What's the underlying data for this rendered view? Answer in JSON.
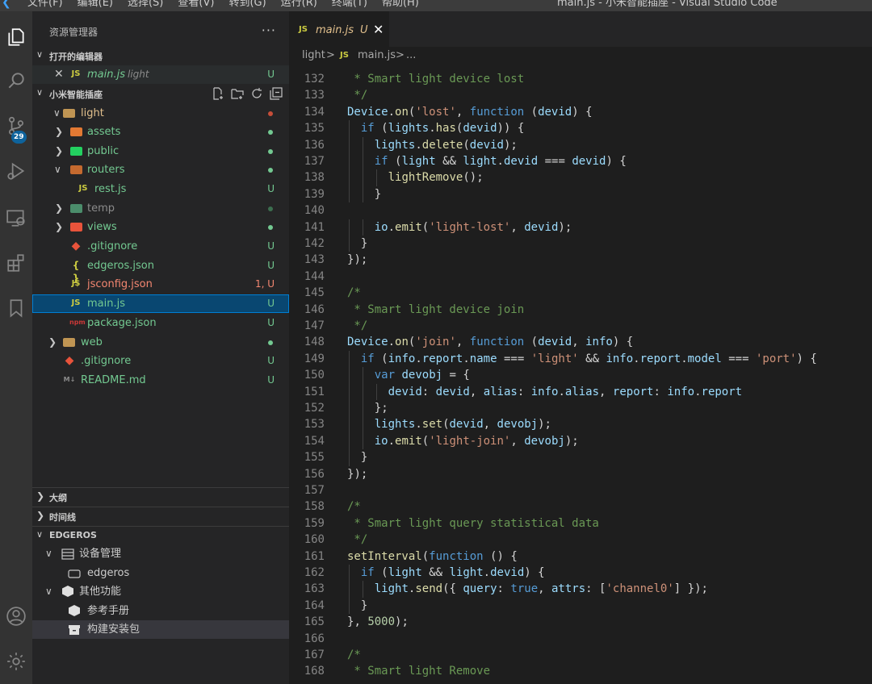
{
  "window": {
    "menu": [
      "文件(F)",
      "编辑(E)",
      "选择(S)",
      "查看(V)",
      "转到(G)",
      "运行(R)",
      "终端(T)",
      "帮助(H)"
    ],
    "title": "main.js - 小米智能插座 - Visual Studio Code"
  },
  "activity_bar": {
    "items": [
      {
        "name": "explorer-icon",
        "active": true
      },
      {
        "name": "search-icon"
      },
      {
        "name": "source-control-icon",
        "badge": "29"
      },
      {
        "name": "run-debug-icon"
      },
      {
        "name": "remote-explorer-icon"
      },
      {
        "name": "extensions-icon"
      },
      {
        "name": "bookmarks-icon"
      }
    ],
    "bottom": [
      {
        "name": "account-icon"
      },
      {
        "name": "settings-gear-icon"
      }
    ]
  },
  "sidebar": {
    "title": "资源管理器",
    "more": "···",
    "open_editors": {
      "label": "打开的编辑器",
      "items": [
        {
          "icon": "JS",
          "name": "main.js",
          "folder": "light",
          "status": "U"
        }
      ]
    },
    "workspace": {
      "label": "小米智能插座",
      "tree": [
        {
          "name": "light",
          "kind": "folder",
          "depth": 1,
          "expanded": true,
          "dot": "#c74e39",
          "color": "mod"
        },
        {
          "name": "assets",
          "kind": "folder",
          "depth": 2,
          "expanded": false,
          "dot": "#73c991",
          "color": "green",
          "icon_color": "#e37933"
        },
        {
          "name": "public",
          "kind": "folder",
          "depth": 2,
          "expanded": false,
          "dot": "#73c991",
          "color": "green",
          "icon_color": "#23d160"
        },
        {
          "name": "routers",
          "kind": "folder",
          "depth": 2,
          "expanded": true,
          "dot": "#73c991",
          "color": "green",
          "icon_color": "#c56a2f"
        },
        {
          "name": "rest.js",
          "kind": "js",
          "depth": 3,
          "status": "U",
          "color": "green"
        },
        {
          "name": "temp",
          "kind": "folder",
          "depth": 2,
          "expanded": false,
          "dot": "#3c6f4f",
          "color": "dim",
          "icon_color": "#4b8d6b"
        },
        {
          "name": "views",
          "kind": "folder",
          "depth": 2,
          "expanded": false,
          "dot": "#73c991",
          "color": "green",
          "icon_color": "#e8533b"
        },
        {
          "name": ".gitignore",
          "kind": "git",
          "depth": 2,
          "status": "U",
          "color": "green"
        },
        {
          "name": "edgeros.json",
          "kind": "json",
          "depth": 2,
          "status": "U",
          "color": "green"
        },
        {
          "name": "jsconfig.json",
          "kind": "js",
          "depth": 2,
          "status": "1, U",
          "color": "err"
        },
        {
          "name": "main.js",
          "kind": "js",
          "depth": 2,
          "status": "U",
          "color": "green",
          "selected": true
        },
        {
          "name": "package.json",
          "kind": "npm",
          "depth": 2,
          "status": "U",
          "color": "green"
        },
        {
          "name": "web",
          "kind": "folder",
          "depth": 1,
          "expanded": false,
          "dot": "#73c991",
          "color": "green"
        },
        {
          "name": ".gitignore",
          "kind": "git",
          "depth": 1,
          "status": "U",
          "color": "green"
        },
        {
          "name": "README.md",
          "kind": "md",
          "depth": 1,
          "status": "U",
          "color": "green"
        }
      ]
    },
    "outline": {
      "label": "大纲"
    },
    "timeline": {
      "label": "时间线"
    },
    "edgeros": {
      "label": "EDGEROS",
      "items": [
        {
          "label": "设备管理",
          "depth": 1,
          "icon": "list-icon"
        },
        {
          "label": "edgeros",
          "depth": 2,
          "icon": "device-icon"
        },
        {
          "label": "其他功能",
          "depth": 1,
          "icon": "package-icon"
        },
        {
          "label": "参考手册",
          "depth": 2,
          "icon": "package-icon"
        },
        {
          "label": "构建安装包",
          "depth": 2,
          "icon": "archive-icon"
        }
      ]
    }
  },
  "editor": {
    "tab": {
      "icon": "JS",
      "name": "main.js",
      "status": "U",
      "close": "✕"
    },
    "breadcrumb": [
      "light",
      ">",
      "JS",
      "main.js",
      ">",
      "..."
    ],
    "code": [
      {
        "n": "132",
        "t": " * Smart light device lost"
      },
      {
        "n": "133",
        "t": " */"
      },
      {
        "n": "134",
        "t": "Device.on('lost', function (devid) {"
      },
      {
        "n": "135",
        "t": "  if (lights.has(devid)) {"
      },
      {
        "n": "136",
        "t": "    lights.delete(devid);"
      },
      {
        "n": "137",
        "t": "    if (light && light.devid === devid) {"
      },
      {
        "n": "138",
        "t": "      lightRemove();"
      },
      {
        "n": "139",
        "t": "    }"
      },
      {
        "n": "140",
        "t": ""
      },
      {
        "n": "141",
        "t": "    io.emit('light-lost', devid);"
      },
      {
        "n": "142",
        "t": "  }"
      },
      {
        "n": "143",
        "t": "});"
      },
      {
        "n": "144",
        "t": ""
      },
      {
        "n": "145",
        "t": "/*"
      },
      {
        "n": "146",
        "t": " * Smart light device join"
      },
      {
        "n": "147",
        "t": " */"
      },
      {
        "n": "148",
        "t": "Device.on('join', function (devid, info) {"
      },
      {
        "n": "149",
        "t": "  if (info.report.name === 'light' && info.report.model === 'port') {"
      },
      {
        "n": "150",
        "t": "    var devobj = {"
      },
      {
        "n": "151",
        "t": "      devid: devid, alias: info.alias, report: info.report"
      },
      {
        "n": "152",
        "t": "    };"
      },
      {
        "n": "153",
        "t": "    lights.set(devid, devobj);"
      },
      {
        "n": "154",
        "t": "    io.emit('light-join', devobj);"
      },
      {
        "n": "155",
        "t": "  }"
      },
      {
        "n": "156",
        "t": "});"
      },
      {
        "n": "157",
        "t": ""
      },
      {
        "n": "158",
        "t": "/*"
      },
      {
        "n": "159",
        "t": " * Smart light query statistical data"
      },
      {
        "n": "160",
        "t": " */"
      },
      {
        "n": "161",
        "t": "setInterval(function () {"
      },
      {
        "n": "162",
        "t": "  if (light && light.devid) {"
      },
      {
        "n": "163",
        "t": "    light.send({ query: true, attrs: ['channel0'] });"
      },
      {
        "n": "164",
        "t": "  }"
      },
      {
        "n": "165",
        "t": "}, 5000);"
      },
      {
        "n": "166",
        "t": ""
      },
      {
        "n": "167",
        "t": "/*"
      },
      {
        "n": "168",
        "t": " * Smart light Remove"
      }
    ]
  }
}
